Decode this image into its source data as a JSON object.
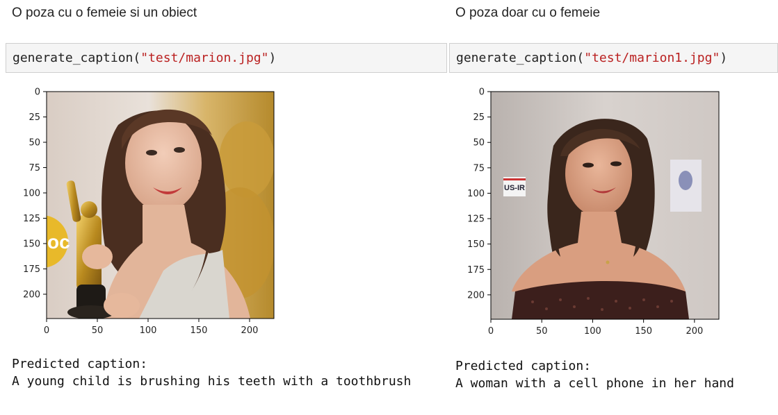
{
  "left": {
    "heading": "O poza cu o femeie si un obiect",
    "code_fn": "generate_caption(",
    "code_arg": "\"test/marion.jpg\"",
    "code_close": ")",
    "plot": {
      "x_ticks": [
        "0",
        "50",
        "100",
        "150",
        "200"
      ],
      "y_ticks": [
        "0",
        "25",
        "50",
        "75",
        "100",
        "125",
        "150",
        "175",
        "200"
      ],
      "image": "photo-woman-holding-oscar-statuette"
    },
    "output_header": "Predicted caption:",
    "output_text": "A young child is brushing his teeth with a toothbrush"
  },
  "right": {
    "heading": "O poza doar cu o femeie",
    "code_fn": "generate_caption(",
    "code_arg": "\"test/marion1.jpg\"",
    "code_close": ")",
    "plot": {
      "x_ticks": [
        "0",
        "50",
        "100",
        "150",
        "200"
      ],
      "y_ticks": [
        "0",
        "25",
        "50",
        "75",
        "100",
        "125",
        "150",
        "175",
        "200"
      ],
      "image": "photo-woman-portrait"
    },
    "output_header": "Predicted caption:",
    "output_text": "A woman with a cell phone in her hand"
  }
}
